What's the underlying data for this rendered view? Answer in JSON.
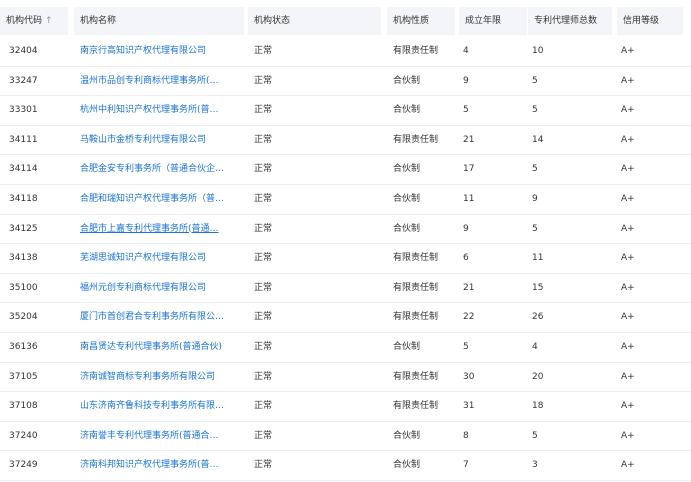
{
  "columns": {
    "code": "机构代码",
    "sort_icon": "↑",
    "name": "机构名称",
    "status": "机构状态",
    "type": "机构性质",
    "years": "成立年限",
    "agents": "专利代理师总数",
    "credit": "信用等级"
  },
  "rows": [
    {
      "code": "32404",
      "name": "南京行高知识产权代理有限公司",
      "status": "正常",
      "type": "有限责任制",
      "years": "4",
      "agents": "10",
      "credit": "A+"
    },
    {
      "code": "33247",
      "name": "温州市品创专利商标代理事务所(…",
      "status": "正常",
      "type": "合伙制",
      "years": "9",
      "agents": "5",
      "credit": "A+"
    },
    {
      "code": "33301",
      "name": "杭州中利知识产权代理事务所(普…",
      "status": "正常",
      "type": "合伙制",
      "years": "5",
      "agents": "5",
      "credit": "A+"
    },
    {
      "code": "34111",
      "name": "马鞍山市金桥专利代理有限公司",
      "status": "正常",
      "type": "有限责任制",
      "years": "21",
      "agents": "14",
      "credit": "A+"
    },
    {
      "code": "34114",
      "name": "合肥金安专利事务所（普通合伙企…",
      "status": "正常",
      "type": "合伙制",
      "years": "17",
      "agents": "5",
      "credit": "A+"
    },
    {
      "code": "34118",
      "name": "合肥和瑞知识产权代理事务所（普…",
      "status": "正常",
      "type": "合伙制",
      "years": "11",
      "agents": "9",
      "credit": "A+"
    },
    {
      "code": "34125",
      "name": "合肥市上嘉专利代理事务所(普通…",
      "status": "正常",
      "type": "合伙制",
      "years": "9",
      "agents": "5",
      "credit": "A+",
      "underlined": true
    },
    {
      "code": "34138",
      "name": "芜湖思诚知识产权代理有限公司",
      "status": "正常",
      "type": "有限责任制",
      "years": "6",
      "agents": "11",
      "credit": "A+"
    },
    {
      "code": "35100",
      "name": "福州元创专利商标代理有限公司",
      "status": "正常",
      "type": "有限责任制",
      "years": "21",
      "agents": "15",
      "credit": "A+"
    },
    {
      "code": "35204",
      "name": "厦门市首创君合专利事务所有限公…",
      "status": "正常",
      "type": "有限责任制",
      "years": "22",
      "agents": "26",
      "credit": "A+"
    },
    {
      "code": "36136",
      "name": "南昌贤达专利代理事务所(普通合伙)",
      "status": "正常",
      "type": "合伙制",
      "years": "5",
      "agents": "4",
      "credit": "A+"
    },
    {
      "code": "37105",
      "name": "济南诚智商标专利事务所有限公司",
      "status": "正常",
      "type": "有限责任制",
      "years": "30",
      "agents": "20",
      "credit": "A+"
    },
    {
      "code": "37108",
      "name": "山东济南齐鲁科技专利事务所有限…",
      "status": "正常",
      "type": "有限责任制",
      "years": "31",
      "agents": "18",
      "credit": "A+"
    },
    {
      "code": "37240",
      "name": "济南誉丰专利代理事务所(普通合…",
      "status": "正常",
      "type": "合伙制",
      "years": "8",
      "agents": "5",
      "credit": "A+"
    },
    {
      "code": "37249",
      "name": "济南科邦知识产权代理事务所(普…",
      "status": "正常",
      "type": "合伙制",
      "years": "7",
      "agents": "3",
      "credit": "A+"
    }
  ]
}
